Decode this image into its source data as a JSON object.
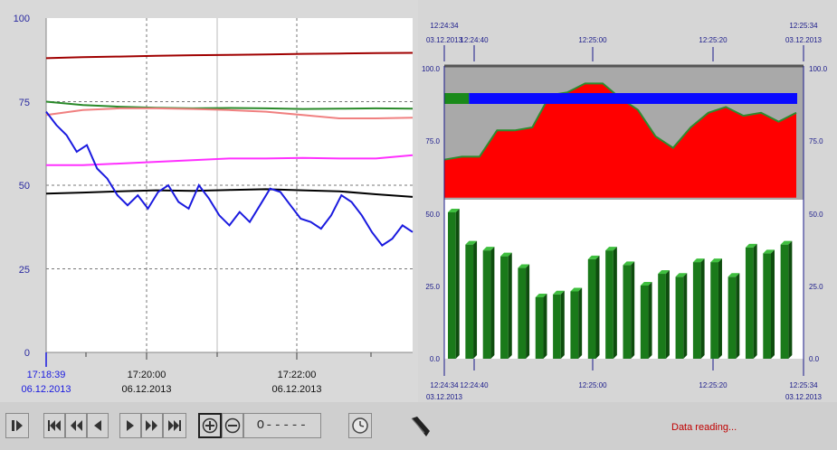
{
  "colors": {
    "trend_red": "#a00000",
    "trend_green": "#2a8a2a",
    "trend_salmon": "#f08080",
    "trend_magenta": "#ff30ff",
    "trend_black": "#000000",
    "trend_blue": "#1a1adf",
    "area_fill": "#ff0000",
    "area_line": "#2e8b2e",
    "bar_fill": "#1a7a1a",
    "status_red": "#c00000",
    "state_bar_green": "#1a8a1a",
    "state_bar_blue": "#0a0aff"
  },
  "left_chart": {
    "y_ticks": [
      "100",
      "75",
      "50",
      "25",
      "0"
    ],
    "x_labels": [
      {
        "time": "17:18:39",
        "date": "06.12.2013"
      },
      {
        "time": "17:20:00",
        "date": "06.12.2013"
      },
      {
        "time": "17:22:00",
        "date": "06.12.2013"
      }
    ]
  },
  "chart_data": [
    {
      "type": "line",
      "ylim": [
        0,
        100
      ],
      "x_range": [
        "17:18:39",
        "17:23:25"
      ],
      "series": [
        {
          "color": "#a00000",
          "values": [
            88,
            88.3,
            88.5,
            88.7,
            88.9,
            89.0,
            89.1,
            89.3,
            89.4,
            89.5,
            89.6
          ]
        },
        {
          "color": "#2a8a2a",
          "values": [
            75,
            74,
            73.5,
            73.2,
            73.0,
            73.1,
            73.0,
            72.8,
            72.9,
            73.0,
            72.9
          ]
        },
        {
          "color": "#f08080",
          "values": [
            71,
            72.5,
            73,
            73,
            72.8,
            72.5,
            72,
            71,
            70,
            70,
            70.2
          ]
        },
        {
          "color": "#ff30ff",
          "values": [
            56,
            56,
            56.5,
            57,
            57.5,
            58,
            58,
            58.2,
            58,
            58,
            59
          ]
        },
        {
          "color": "#000000",
          "values": [
            47.5,
            47.8,
            48.2,
            48.5,
            48.3,
            48.6,
            48.8,
            48.5,
            48.2,
            47.3,
            46.5
          ]
        },
        {
          "color": "#1a1adf",
          "values": [
            72,
            68,
            65,
            60,
            62,
            55,
            52,
            47,
            44,
            47,
            43,
            48,
            50,
            45,
            43,
            50,
            46,
            41,
            38,
            42,
            39,
            44,
            49,
            48,
            44,
            40,
            39,
            37,
            41,
            47,
            45,
            41,
            36,
            32,
            34,
            38,
            36
          ]
        }
      ]
    },
    {
      "type": "area",
      "ylim": [
        0,
        100
      ],
      "x_range": [
        "12:24:34",
        "12:25:34"
      ],
      "values": [
        68,
        69,
        69,
        78,
        78,
        79,
        90,
        91,
        94,
        94,
        89,
        85,
        76,
        72,
        79,
        84,
        86,
        83,
        84,
        81,
        84
      ],
      "baseline": 55
    },
    {
      "type": "bar",
      "ylim": [
        0,
        100
      ],
      "values": [
        50,
        39,
        37,
        35,
        31,
        21,
        22,
        23,
        34,
        37,
        32,
        25,
        29,
        28,
        33,
        33,
        28,
        38,
        36,
        39
      ]
    }
  ],
  "right_chart": {
    "top_time_labels": [
      {
        "time": "12:24:34",
        "date": "03.12.2013"
      },
      {
        "time": "12:24:40",
        "date": ""
      },
      {
        "time": "12:25:00",
        "date": ""
      },
      {
        "time": "12:25:20",
        "date": ""
      },
      {
        "time": "12:25:34",
        "date": "03.12.2013"
      }
    ],
    "bottom_time_labels": [
      {
        "time": "12:24:34",
        "date": "03.12.2013"
      },
      {
        "time": "12:24:40",
        "date": ""
      },
      {
        "time": "12:25:00",
        "date": ""
      },
      {
        "time": "12:25:20",
        "date": ""
      },
      {
        "time": "12:25:34",
        "date": "03.12.2013"
      }
    ],
    "y_ticks_left": [
      "100.0",
      "75.0",
      "50.0",
      "25.0",
      "0.0"
    ],
    "y_ticks_right": [
      "100.0",
      "75.0",
      "50.0",
      "25.0",
      "0.0"
    ],
    "state_bar": {
      "green_fraction": 0.07
    }
  },
  "toolbar": {
    "zoom_slider_label": "O-----",
    "icons": [
      "stop-start-icon",
      "first-icon",
      "fast-back-icon",
      "back-icon",
      "play-icon",
      "fast-forward-icon",
      "last-icon",
      "zoom-in-icon",
      "zoom-out-icon",
      "clock-icon",
      "ruler-icon"
    ]
  },
  "status": {
    "text": "Data reading..."
  }
}
